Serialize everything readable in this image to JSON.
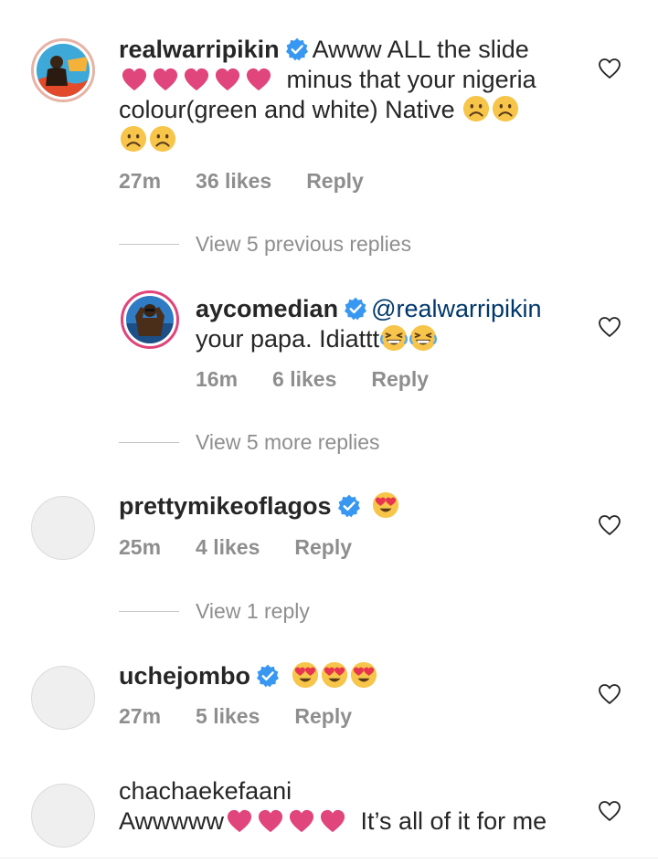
{
  "comments": [
    {
      "username": "realwarripikin",
      "text_1": "Awww ALL the slide",
      "text_2": "minus that your nigeria",
      "text_3": "colour(green and white)  Native",
      "time": "27m",
      "likes": "36 likes",
      "reply": "Reply",
      "emojis": [
        "heart",
        "heart",
        "heart",
        "heart",
        "heart",
        "frowning-face",
        "frowning-face",
        "frowning-face",
        "frowning-face"
      ]
    },
    {
      "username": "aycomedian",
      "mention": "@realwarripikin",
      "text_1": "your papa. Idiattt",
      "time": "16m",
      "likes": "6 likes",
      "reply": "Reply",
      "emojis": [
        "grinning-squinting-face",
        "grinning-squinting-face"
      ]
    },
    {
      "username": "prettymikeoflagos",
      "time": "25m",
      "likes": "4 likes",
      "reply": "Reply",
      "emojis": [
        "heart-eyes-face"
      ]
    },
    {
      "username": "uchejombo",
      "time": "27m",
      "likes": "5 likes",
      "reply": "Reply",
      "emojis": [
        "heart-eyes-face",
        "heart-eyes-face",
        "heart-eyes-face"
      ]
    },
    {
      "username": "chachaekefaani",
      "text_1": "Awwwww",
      "text_2": "It’s all of it for me",
      "emojis": [
        "heart",
        "heart",
        "heart",
        "heart"
      ]
    }
  ],
  "view_replies": {
    "previous": "View 5 previous replies",
    "more": "View 5 more replies",
    "one": "View 1 reply"
  },
  "colors": {
    "text": "#262626",
    "secondary": "#8e8e8e",
    "mention": "#00376b",
    "verified": "#3897f0",
    "heart": "#e0457b"
  }
}
